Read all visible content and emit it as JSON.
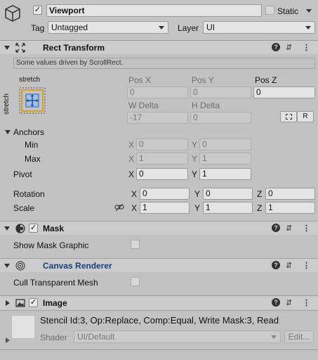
{
  "object": {
    "name": "Viewport",
    "active": true,
    "static_label": "Static",
    "static_checked": false,
    "tag_label": "Tag",
    "tag_value": "Untagged",
    "layer_label": "Layer",
    "layer_value": "UI"
  },
  "rect_transform": {
    "title": "Rect Transform",
    "notice": "Some values driven by ScrollRect.",
    "anchor_h": "stretch",
    "anchor_v": "stretch",
    "posx_label": "Pos X",
    "posy_label": "Pos Y",
    "posz_label": "Pos Z",
    "posx": "0",
    "posy": "0",
    "posz": "0",
    "wdelta_label": "W Delta",
    "hdelta_label": "H Delta",
    "wdelta": "-17",
    "hdelta": "0",
    "r_button": "R",
    "anchors_label": "Anchors",
    "min_label": "Min",
    "max_label": "Max",
    "min_x": "0",
    "min_y": "0",
    "max_x": "1",
    "max_y": "1",
    "pivot_label": "Pivot",
    "pivot_x": "0",
    "pivot_y": "1",
    "rotation_label": "Rotation",
    "rot_x": "0",
    "rot_y": "0",
    "rot_z": "0",
    "scale_label": "Scale",
    "scale_x": "1",
    "scale_y": "1",
    "scale_z": "1",
    "x": "X",
    "y": "Y",
    "z": "Z"
  },
  "mask": {
    "title": "Mask",
    "enabled": true,
    "show_graphic_label": "Show Mask Graphic",
    "show_graphic": false
  },
  "canvas_renderer": {
    "title": "Canvas Renderer",
    "title_color": "#1a3f7a",
    "cull_label": "Cull Transparent Mesh",
    "cull": false
  },
  "image": {
    "title": "Image",
    "enabled": true,
    "stencil_info": "Stencil Id:3, Op:Replace, Comp:Equal, Write Mask:3, Read",
    "shader_label": "Shader",
    "shader_value": "UI/Default",
    "edit_button": "Edit..."
  },
  "icons": {
    "gameobject": "cube-icon",
    "rect_transform": "rect-transform-icon",
    "mask": "mask-icon",
    "canvas_renderer": "canvas-renderer-icon",
    "image": "image-icon",
    "help": "help-icon",
    "presets": "presets-icon",
    "menu": "kebab-menu-icon",
    "blueprint": "blueprint-icon",
    "link": "link-icon"
  }
}
